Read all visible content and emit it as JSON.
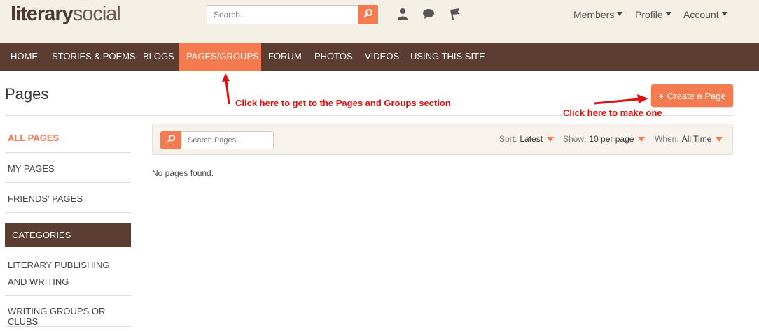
{
  "header": {
    "logo_bold": "literary",
    "logo_light": "social",
    "search_placeholder": "Search...",
    "menus": {
      "members": "Members",
      "profile": "Profile",
      "account": "Account"
    }
  },
  "nav": {
    "items": [
      "HOME",
      "STORIES & POEMS",
      "BLOGS",
      "PAGES/GROUPS",
      "FORUM",
      "PHOTOS",
      "VIDEOS",
      "USING THIS SITE"
    ],
    "active": "PAGES/GROUPS"
  },
  "page": {
    "title": "Pages",
    "create_label": "Create a Page",
    "empty_message": "No pages found."
  },
  "annotations": {
    "nav_hint": "Click here to get to the Pages and Groups section",
    "create_hint": "Click here to make one"
  },
  "sidebar": {
    "items": [
      "ALL PAGES",
      "MY PAGES",
      "FRIENDS' PAGES"
    ],
    "categories_header": "CATEGORIES",
    "categories": [
      "LITERARY PUBLISHING AND WRITING",
      "WRITING GROUPS OR CLUBS"
    ]
  },
  "filters": {
    "search_placeholder": "Search Pages...",
    "sort_label": "Sort:",
    "sort_value": "Latest",
    "show_label": "Show:",
    "show_value": "10 per page",
    "when_label": "When:",
    "when_value": "All Time"
  },
  "colors": {
    "accent": "#f47a4f",
    "nav_bg": "#5c3d31",
    "header_bg": "#f5f0e6",
    "annotation": "#e01010"
  },
  "icons": [
    "search-icon",
    "user-icon",
    "chat-bubble-icon",
    "flag-icon",
    "plus-icon",
    "arrow-up-icon",
    "arrow-right-icon"
  ]
}
